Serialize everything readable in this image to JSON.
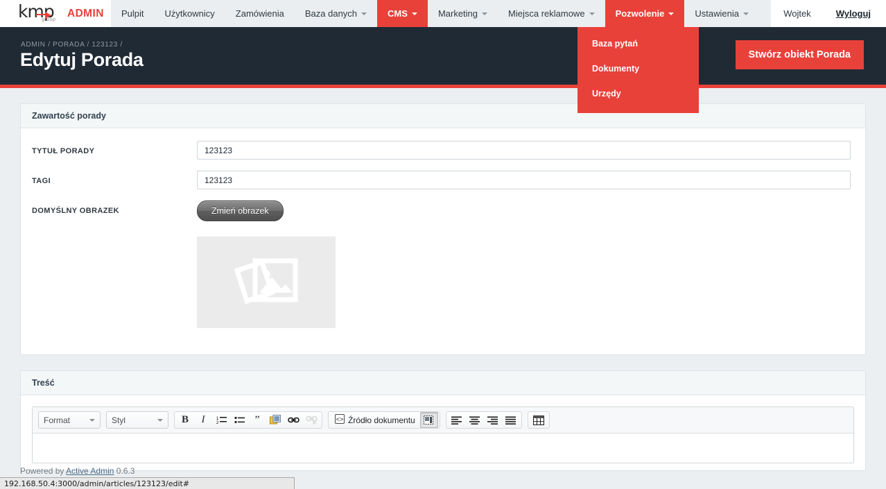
{
  "brand": {
    "logo_text": "kmp",
    "logo_sub": "group",
    "admin_label": "ADMIN"
  },
  "nav": {
    "items": [
      {
        "label": "Pulpit",
        "has_caret": false,
        "active": false
      },
      {
        "label": "Użytkownicy",
        "has_caret": false,
        "active": false
      },
      {
        "label": "Zamówienia",
        "has_caret": false,
        "active": false
      },
      {
        "label": "Baza danych",
        "has_caret": true,
        "active": false
      },
      {
        "label": "CMS",
        "has_caret": true,
        "active": true
      },
      {
        "label": "Marketing",
        "has_caret": true,
        "active": false
      },
      {
        "label": "Miejsca reklamowe",
        "has_caret": true,
        "active": false
      },
      {
        "label": "Pozwolenie",
        "has_caret": true,
        "active": true
      },
      {
        "label": "Ustawienia",
        "has_caret": true,
        "active": false
      }
    ],
    "user": "Wojtek",
    "logout": "Wyloguj"
  },
  "dropdown": {
    "parent": "Pozwolenie",
    "items": [
      {
        "label": "Baza pytań"
      },
      {
        "label": "Dokumenty"
      },
      {
        "label": "Urzędy"
      }
    ]
  },
  "page": {
    "breadcrumb": "ADMIN / PORADA / 123123 /",
    "title": "Edytuj Porada",
    "action_button": "Stwórz obiekt Porada"
  },
  "panels": {
    "content_panel": {
      "heading": "Zawartość porady",
      "fields": [
        {
          "label": "TYTUŁ PORADY",
          "value": "123123",
          "placeholder": ""
        },
        {
          "label": "TAGI",
          "value": "123123",
          "placeholder": ""
        }
      ],
      "image_field": {
        "label": "DOMYŚLNY OBRAZEK",
        "button": "Zmień obrazek",
        "placeholder_icon": "image-placeholder-icon"
      }
    },
    "body_panel": {
      "heading": "Treść",
      "editor": {
        "format_select": "Format",
        "style_select": "Styl",
        "buttons": [
          {
            "name": "bold",
            "glyph": "B",
            "state": "normal"
          },
          {
            "name": "italic",
            "glyph": "I",
            "state": "normal"
          },
          {
            "name": "numbered-list",
            "glyph": "",
            "state": "normal"
          },
          {
            "name": "bulleted-list",
            "glyph": "",
            "state": "normal"
          },
          {
            "name": "blockquote",
            "glyph": "❞",
            "state": "normal"
          },
          {
            "name": "image",
            "glyph": "",
            "state": "normal"
          },
          {
            "name": "link",
            "glyph": "",
            "state": "normal"
          },
          {
            "name": "unlink",
            "glyph": "",
            "state": "disabled"
          }
        ],
        "source_button": "Źródło dokumentu",
        "templates_button_state": "pressed",
        "align_buttons": [
          "align-left",
          "align-center",
          "align-right",
          "align-justify"
        ],
        "table_button": "table",
        "content": ""
      }
    }
  },
  "footer": {
    "prefix": "Powered by",
    "link": "Active Admin",
    "version": "0.6.3"
  },
  "statusbar": {
    "url": "192.168.50.4:3000/admin/articles/123123/edit#"
  },
  "colors": {
    "accent_red": "#e8413a",
    "header_dark": "#1f2a35",
    "page_bg": "#eceff1",
    "nav_bg": "#ebeef0"
  }
}
